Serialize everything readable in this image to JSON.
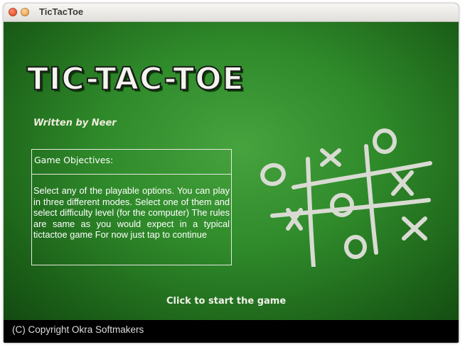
{
  "window": {
    "title": "TicTacToe"
  },
  "game": {
    "logo_title": "TIC-TAC-TOE",
    "subtitle": "Written by Neer",
    "objectives": {
      "heading": "Game Objectives:",
      "text": "Select any of the playable options. You can play in three different modes. Select one of them and select difficulty level (for the computer) The rules are same as you would expect in a typical tictactoe game For now just tap to continue"
    },
    "start_label": "Click to start the game",
    "copyright": "(C) Copyright Okra Softmakers"
  },
  "colors": {
    "board_green_dark": "#134a11",
    "board_green_light": "#46a33e",
    "chalk": "#d9dbd3"
  }
}
